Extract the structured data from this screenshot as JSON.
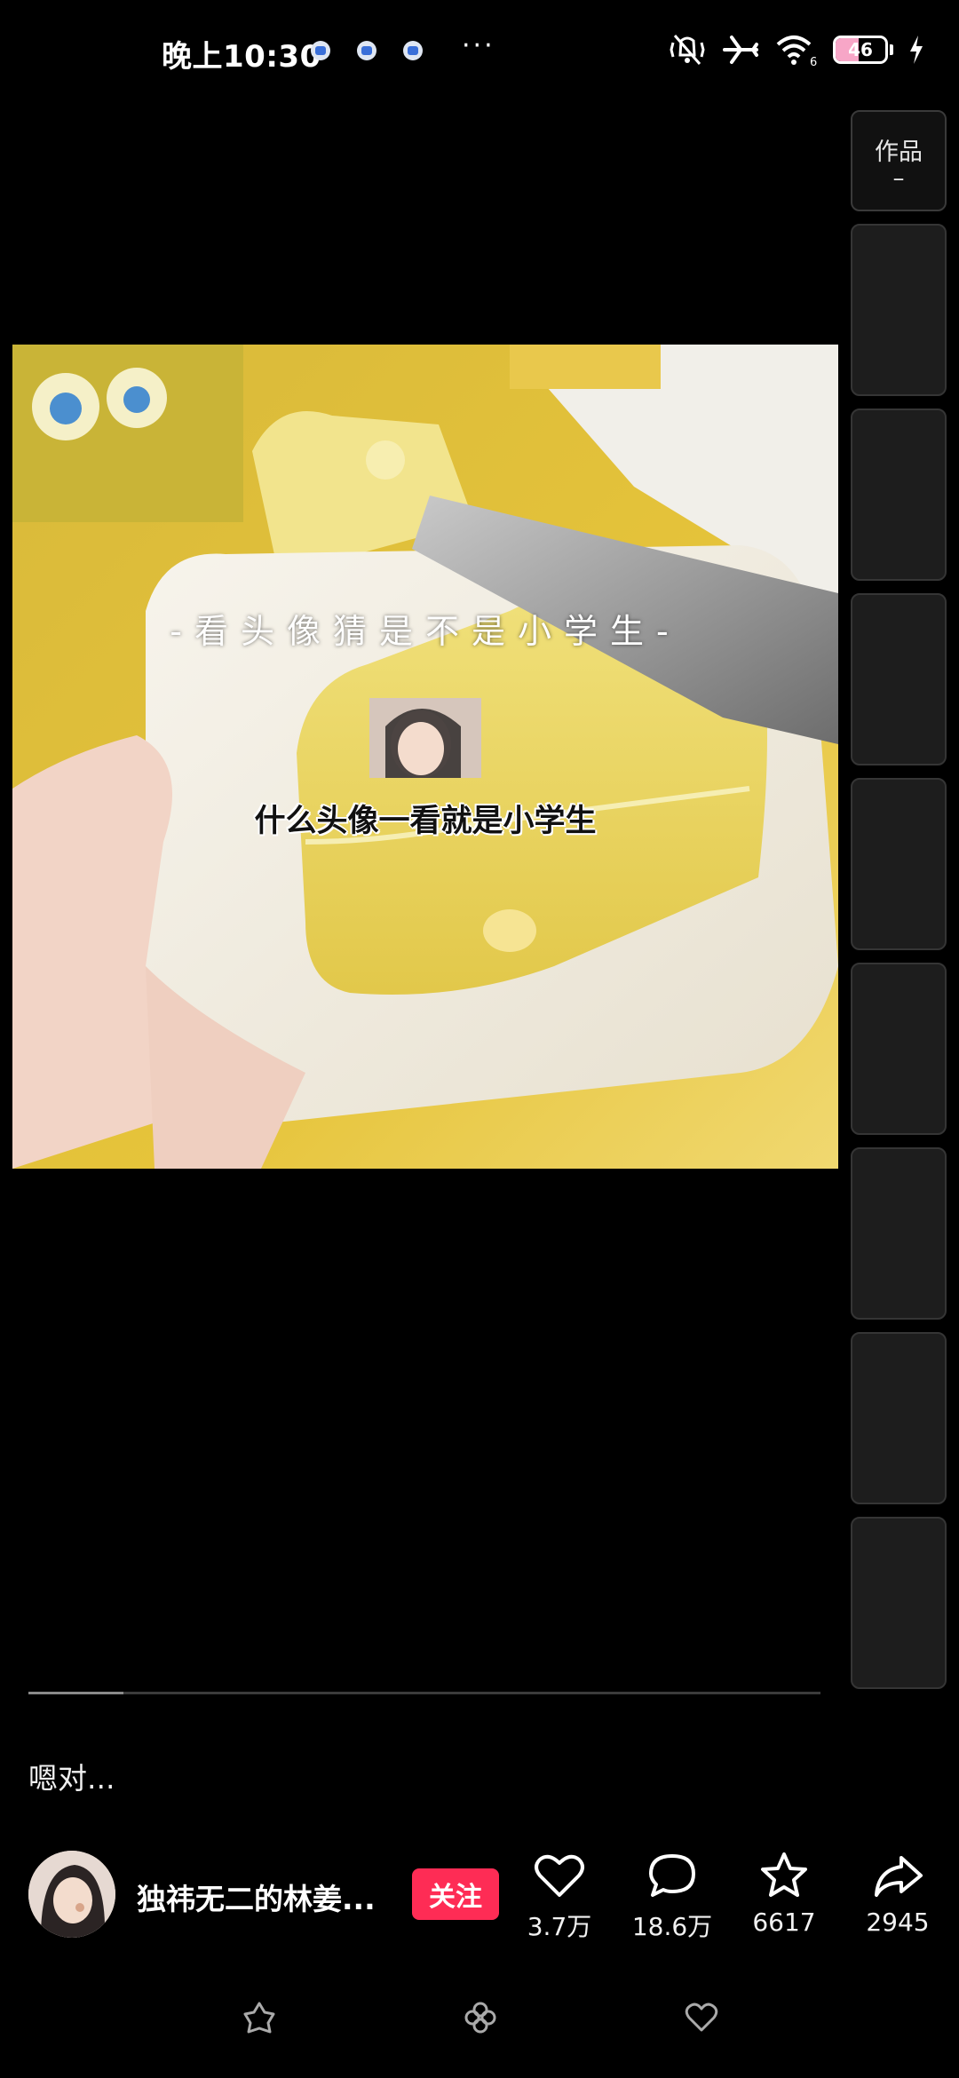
{
  "status_bar": {
    "time": "晚上10:30",
    "more": "···",
    "battery_level": 46,
    "battery_text": "46",
    "wifi_label": "6"
  },
  "side_panel": {
    "tab_label": "作品",
    "tab_dash": "–",
    "thumbnail_count": 8
  },
  "video": {
    "caption_top": "-看头像猜是不是小学生-",
    "caption_bottom": "什么头像一看就是小学生"
  },
  "progress": {
    "fraction": 0.12
  },
  "description": "嗯对...",
  "author": {
    "name": "独祎无二的林姜...",
    "follow_label": "关注"
  },
  "actions": [
    {
      "icon": "heart-icon",
      "count": "3.7万"
    },
    {
      "icon": "comment-icon",
      "count": "18.6万"
    },
    {
      "icon": "star-icon",
      "count": "6617"
    },
    {
      "icon": "share-icon",
      "count": "2945"
    }
  ],
  "colors": {
    "accent": "#fe2c55",
    "background": "#000000"
  }
}
